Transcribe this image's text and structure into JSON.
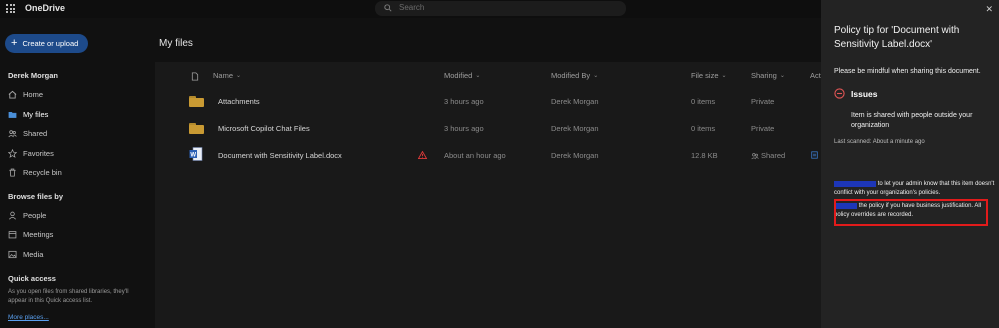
{
  "topbar": {
    "app_name": "OneDrive",
    "search_placeholder": "Search"
  },
  "leftnav": {
    "create_label": "Create or upload",
    "user_name": "Derek Morgan",
    "items": [
      {
        "label": "Home",
        "icon": "home-icon"
      },
      {
        "label": "My files",
        "icon": "folder-icon",
        "active": true
      },
      {
        "label": "Shared",
        "icon": "people-icon"
      },
      {
        "label": "Favorites",
        "icon": "star-icon"
      },
      {
        "label": "Recycle bin",
        "icon": "trash-icon"
      }
    ],
    "browse_title": "Browse files by",
    "browse_items": [
      {
        "label": "People",
        "icon": "person-icon"
      },
      {
        "label": "Meetings",
        "icon": "calendar-icon"
      },
      {
        "label": "Media",
        "icon": "image-icon"
      }
    ],
    "quick_access_title": "Quick access",
    "quick_access_text": "As you open files from shared libraries, they'll appear in this Quick access list.",
    "more_places": "More places..."
  },
  "main": {
    "title": "My files",
    "columns": {
      "name": "Name",
      "modified": "Modified",
      "modified_by": "Modified By",
      "file_size": "File size",
      "sharing": "Sharing",
      "activity": "Act"
    },
    "rows": [
      {
        "name": "Attachments",
        "modified": "3 hours ago",
        "modified_by": "Derek Morgan",
        "file_size": "0 items",
        "sharing": "Private",
        "type": "folder"
      },
      {
        "name": "Microsoft Copilot Chat Files",
        "modified": "3 hours ago",
        "modified_by": "Derek Morgan",
        "file_size": "0 items",
        "sharing": "Private",
        "type": "folder"
      },
      {
        "name": "Document with Sensitivity Label.docx",
        "modified": "About an hour ago",
        "modified_by": "Derek Morgan",
        "file_size": "12.8 KB",
        "sharing": "Shared",
        "type": "docx"
      }
    ]
  },
  "policy_panel": {
    "title": "Policy tip for 'Document with Sensitivity Label.docx'",
    "message": "Please be mindful when sharing this document.",
    "issues_label": "Issues",
    "issue_text": "Item is shared with people outside your organization",
    "last_scanned": "Last scanned: About a minute ago",
    "report_text": "to let your admin know that this item doesn't conflict with your organization's policies.",
    "override_text": "the policy if you have business justification. All policy overrides are recorded."
  },
  "colors": {
    "accent": "#1d4a8a",
    "highlight": "#e21b1b",
    "redaction": "#1d36b8",
    "folder": "#c99a33"
  }
}
